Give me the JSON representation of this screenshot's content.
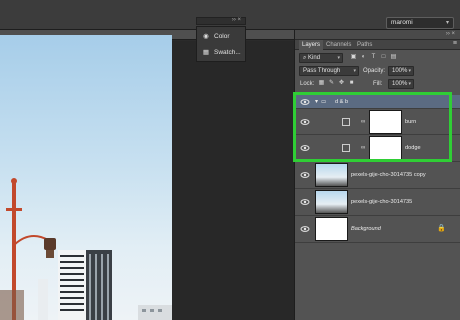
{
  "workspace": {
    "value": "maromi"
  },
  "float_panel": {
    "items": [
      {
        "icon": "color-icon",
        "label": "Color"
      },
      {
        "icon": "swatches-icon",
        "label": "Swatch..."
      }
    ]
  },
  "layers_panel": {
    "tabs": [
      "Layers",
      "Channels",
      "Paths"
    ],
    "kind_label": "Kind",
    "blend_mode": "Pass Through",
    "opacity_label": "Opacity:",
    "opacity_value": "100%",
    "lock_label": "Lock:",
    "fill_label": "Fill:",
    "fill_value": "100%",
    "group": {
      "name": "d & b"
    },
    "layers": [
      {
        "name": "burn",
        "type": "adjustment"
      },
      {
        "name": "dodge",
        "type": "adjustment"
      },
      {
        "name": "pexels-gije-cho-3014735 copy",
        "type": "image"
      },
      {
        "name": "pexels-gije-cho-3014735",
        "type": "image"
      },
      {
        "name": "Background",
        "type": "background",
        "locked": true
      }
    ]
  },
  "colors": {
    "highlight": "#2fce35",
    "group_row": "#5b6b82",
    "lamp_post": "#c2492c",
    "sky": "#a6cde9"
  }
}
